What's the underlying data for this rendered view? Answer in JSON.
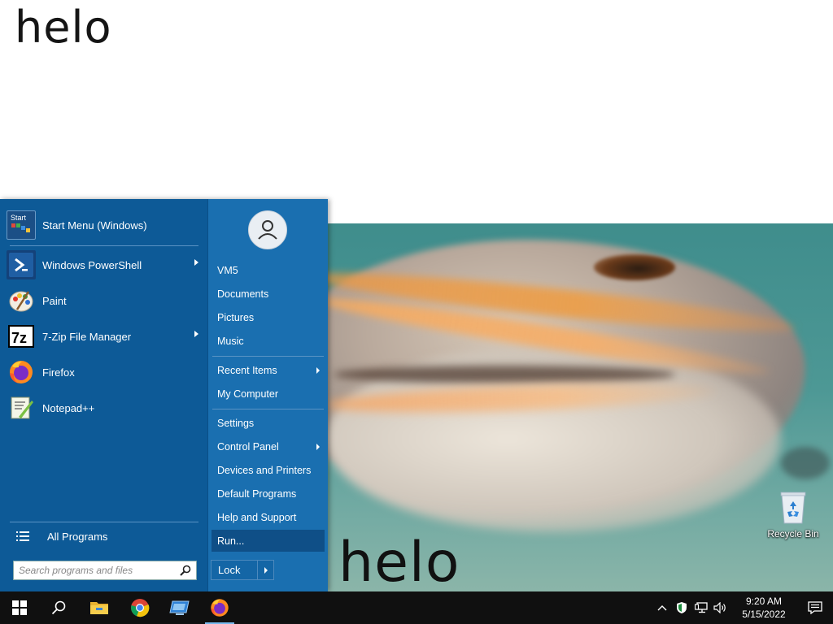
{
  "desktop": {
    "wallpaper_text_top": "helo",
    "wallpaper_text_bottom": "helo",
    "recycle_bin_label": "Recycle Bin"
  },
  "start_menu": {
    "pinned": [
      {
        "label": "Start Menu (Windows)",
        "icon": "start-menu-icon",
        "has_submenu": false
      },
      {
        "label": "Windows PowerShell",
        "icon": "powershell-icon",
        "has_submenu": true
      },
      {
        "label": "Paint",
        "icon": "paint-icon",
        "has_submenu": false
      },
      {
        "label": "7-Zip File Manager",
        "icon": "7zip-icon",
        "has_submenu": true
      },
      {
        "label": "Firefox",
        "icon": "firefox-icon",
        "has_submenu": false
      },
      {
        "label": "Notepad++",
        "icon": "notepadpp-icon",
        "has_submenu": false
      }
    ],
    "start_icon_text": "Start",
    "sevenzip_icon_text": "7z",
    "all_programs_label": "All Programs",
    "search_placeholder": "Search programs and files",
    "places": [
      {
        "label": "VM5",
        "has_submenu": false
      },
      {
        "label": "Documents",
        "has_submenu": false
      },
      {
        "label": "Pictures",
        "has_submenu": false
      },
      {
        "label": "Music",
        "has_submenu": false
      },
      {
        "label": "Recent Items",
        "has_submenu": true
      },
      {
        "label": "My Computer",
        "has_submenu": false
      },
      {
        "label": "Settings",
        "has_submenu": false
      },
      {
        "label": "Control Panel",
        "has_submenu": true
      },
      {
        "label": "Devices and Printers",
        "has_submenu": false
      },
      {
        "label": "Default Programs",
        "has_submenu": false
      },
      {
        "label": "Help and Support",
        "has_submenu": false
      },
      {
        "label": "Run...",
        "has_submenu": false,
        "highlighted": true
      }
    ],
    "lock_label": "Lock"
  },
  "taskbar": {
    "apps": [
      "windows-start-icon",
      "search-icon",
      "file-explorer-icon",
      "chrome-icon",
      "remote-desktop-icon",
      "firefox-icon"
    ],
    "clock_time": "9:20 AM",
    "clock_date": "5/15/2022"
  },
  "colors": {
    "start_left": "#0d5a97",
    "start_right": "#1a6fb0",
    "taskbar": "#101010",
    "highlight": "#0f4f87"
  }
}
